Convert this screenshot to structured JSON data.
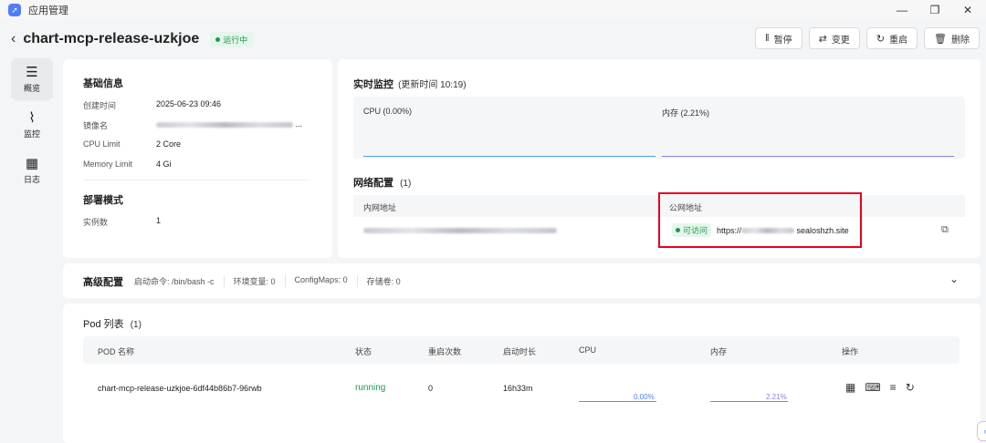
{
  "window": {
    "title": "应用管理",
    "logo_icon": "rocket-icon",
    "controls": [
      "—",
      "❐",
      "✕"
    ]
  },
  "header": {
    "app_name": "chart-mcp-release-uzkjoe",
    "status": "运行中"
  },
  "actions": [
    {
      "label": "暂停",
      "icon": "pause-icon",
      "glyph": "‖"
    },
    {
      "label": "变更",
      "icon": "swap-icon",
      "glyph": "⇄"
    },
    {
      "label": "重启",
      "icon": "restart-icon",
      "glyph": "↻"
    },
    {
      "label": "删除",
      "icon": "trash-icon",
      "glyph": "🗑"
    }
  ],
  "sidebar": [
    {
      "label": "概览",
      "icon": "overview-icon",
      "glyph": "☰",
      "active": true
    },
    {
      "label": "监控",
      "icon": "chart-icon",
      "glyph": "⌇",
      "active": false
    },
    {
      "label": "日志",
      "icon": "calendar-icon",
      "glyph": "▦",
      "active": false
    }
  ],
  "basic": {
    "title": "基础信息",
    "rows": [
      {
        "key": "创建时间",
        "value": "2025-06-23 09:46"
      },
      {
        "key": "镜像名",
        "value": "..."
      },
      {
        "key": "CPU Limit",
        "value": "2 Core"
      },
      {
        "key": "Memory Limit",
        "value": "4 Gi"
      }
    ],
    "deploy_title": "部署模式",
    "deploy_rows": [
      {
        "key": "实例数",
        "value": "1"
      }
    ]
  },
  "monitor": {
    "title": "实时监控",
    "update": "(更新时间  10:19)",
    "cpu_label": "CPU  (0.00%)",
    "mem_label": "内存  (2.21%)",
    "cpu_color": "#4f9bd9",
    "mem_color": "#8c7ee0"
  },
  "network": {
    "title": "网络配置",
    "count": "(1)",
    "col_internal": "内网地址",
    "col_public": "公网地址",
    "access_status": "可访问",
    "public_prefix": "https://",
    "public_suffix": "sealoshzh.site"
  },
  "advanced": {
    "title": "高级配置",
    "items": [
      "启动命令: /bin/bash -c",
      "环境变量: 0",
      "ConfigMaps: 0",
      "存储卷: 0"
    ]
  },
  "pods": {
    "title": "Pod 列表",
    "count": "(1)",
    "columns": [
      "POD 名称",
      "状态",
      "重启次数",
      "启动时长",
      "CPU",
      "内存",
      "操作"
    ],
    "rows": [
      {
        "name": "chart-mcp-release-uzkjoe-6df44b86b7-96rwb",
        "status": "running",
        "restarts": "0",
        "uptime": "16h33m",
        "cpu": "0.00%",
        "mem": "2.21%"
      }
    ]
  }
}
